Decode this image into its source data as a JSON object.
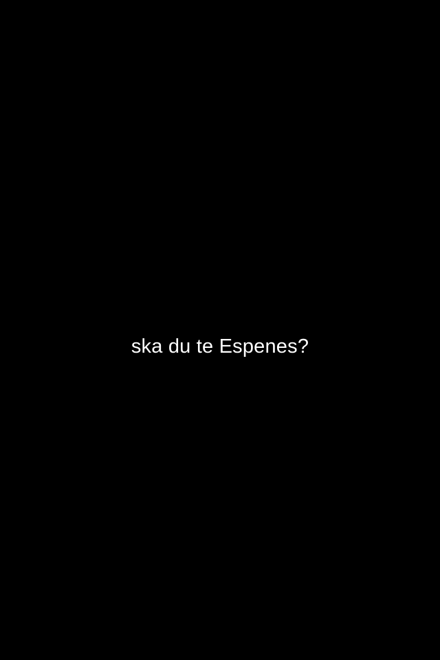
{
  "screen": {
    "background_color": "#000000",
    "caption": {
      "text": "ska du te Espenes?",
      "color": "#ffffff"
    }
  }
}
